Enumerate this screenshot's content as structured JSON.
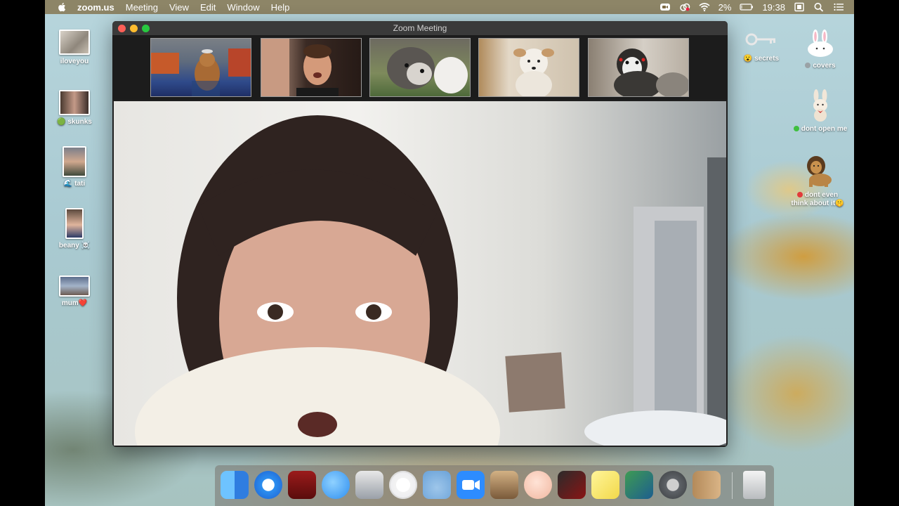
{
  "menubar": {
    "app_name": "zoom.us",
    "menus": [
      "Meeting",
      "View",
      "Edit",
      "Window",
      "Help"
    ],
    "battery": "2%",
    "time": "19:38",
    "icons": [
      "apple-logo",
      "zoom-status-icon",
      "creative-cloud-icon",
      "wifi-icon",
      "battery-icon",
      "display-icon",
      "spotlight-search-icon",
      "notification-center-icon"
    ]
  },
  "zoom_window": {
    "title": "Zoom Meeting",
    "participants": [
      "dog-in-chair",
      "man-singing",
      "fluffy-dog",
      "terrier-dog",
      "husky-dog"
    ],
    "main_speaker": "woman-closeup"
  },
  "desktop_left": [
    {
      "label": "iloveyou",
      "emoji": ""
    },
    {
      "label": "skunks",
      "emoji": "🟢"
    },
    {
      "label": "tati",
      "emoji": "🌊"
    },
    {
      "label": "beany",
      "emoji": "☠️"
    },
    {
      "label": "mum",
      "emoji": "❤️"
    }
  ],
  "desktop_right": [
    {
      "label": "secrets",
      "emoji": "😮"
    },
    {
      "label": "covers",
      "emoji": ""
    },
    {
      "label": "dont open me",
      "emoji": ""
    },
    {
      "label_line1": "dont even",
      "label_line2": "think about it",
      "emoji": "🤫"
    }
  ],
  "dock": [
    "finder",
    "safari",
    "photo-booth",
    "messages",
    "inkscape",
    "itunes",
    "wunderlist",
    "zoom",
    "garageband",
    "vlc-style-face",
    "screenflow",
    "stickies",
    "screen-sharing",
    "system-preferences",
    "contacts",
    "trash"
  ],
  "colors": {
    "close": "#fe5f57",
    "minimize": "#febc2e",
    "zoom": "#28c840",
    "zoom_blue": "#2d8cff"
  }
}
